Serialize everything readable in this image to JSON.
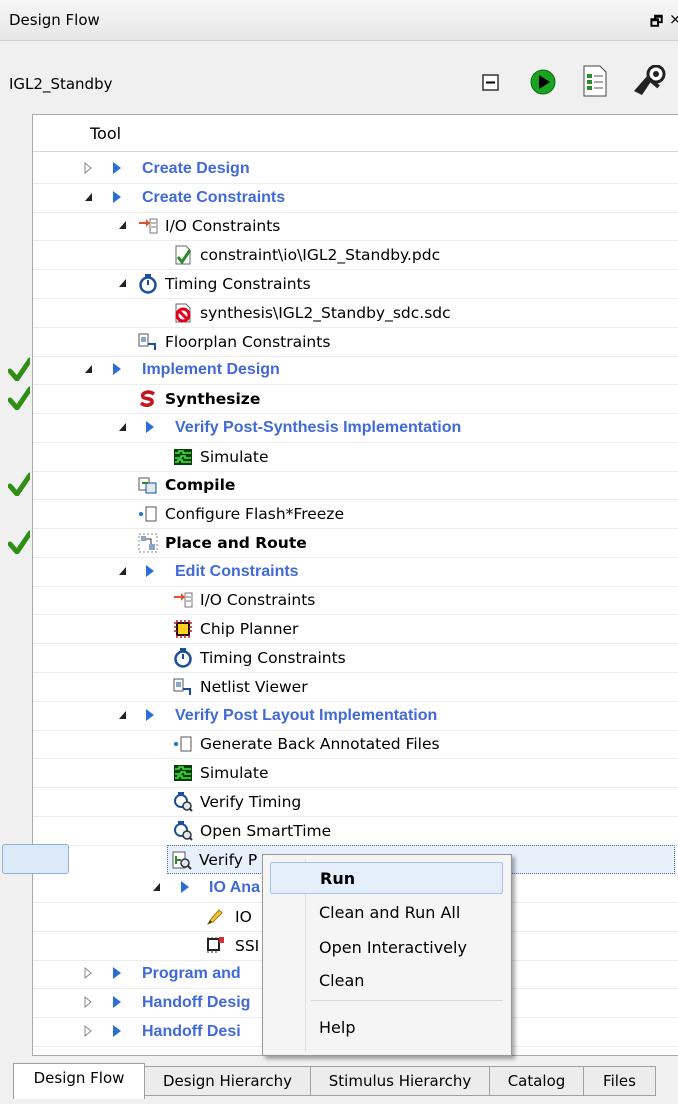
{
  "panel": {
    "title": "Design Flow",
    "restore_glyph": "🗗",
    "close_glyph": "×"
  },
  "project": {
    "name": "IGL2_Standby"
  },
  "toolbar": {
    "icons": [
      "collapse-icon",
      "run-icon",
      "report-icon",
      "configure-icon"
    ]
  },
  "tree": {
    "column_header": "Tool",
    "rows": [
      {
        "label": "Create Design",
        "style": "category",
        "check": false
      },
      {
        "label": "Create Constraints",
        "style": "category",
        "check": false
      },
      {
        "label": "I/O Constraints",
        "style": "normal",
        "check": false
      },
      {
        "label": "constraint\\io\\IGL2_Standby.pdc",
        "style": "normal",
        "check": false
      },
      {
        "label": "Timing Constraints",
        "style": "normal",
        "check": false
      },
      {
        "label": "synthesis\\IGL2_Standby_sdc.sdc",
        "style": "normal",
        "check": false
      },
      {
        "label": "Floorplan Constraints",
        "style": "normal",
        "check": false
      },
      {
        "label": "Implement Design",
        "style": "category",
        "check": true
      },
      {
        "label": "Synthesize",
        "style": "bold",
        "check": true
      },
      {
        "label": "Verify Post-Synthesis Implementation",
        "style": "category",
        "check": false
      },
      {
        "label": "Simulate",
        "style": "normal",
        "check": false
      },
      {
        "label": "Compile",
        "style": "bold",
        "check": true
      },
      {
        "label": "Configure Flash*Freeze",
        "style": "normal",
        "check": false
      },
      {
        "label": "Place and Route",
        "style": "bold",
        "check": true
      },
      {
        "label": "Edit Constraints",
        "style": "category",
        "check": false
      },
      {
        "label": "I/O Constraints",
        "style": "normal",
        "check": false
      },
      {
        "label": "Chip Planner",
        "style": "normal",
        "check": false
      },
      {
        "label": "Timing Constraints",
        "style": "normal",
        "check": false
      },
      {
        "label": "Netlist Viewer",
        "style": "normal",
        "check": false
      },
      {
        "label": "Verify Post Layout Implementation",
        "style": "category",
        "check": false
      },
      {
        "label": "Generate Back Annotated Files",
        "style": "normal",
        "check": false
      },
      {
        "label": "Simulate",
        "style": "normal",
        "check": false
      },
      {
        "label": "Verify Timing",
        "style": "normal",
        "check": false
      },
      {
        "label": "Open SmartTime",
        "style": "normal",
        "check": false
      },
      {
        "label": "Verify P",
        "style": "normal",
        "check": false,
        "selected": true
      },
      {
        "label": "IO Ana",
        "style": "category",
        "check": false
      },
      {
        "label": "IO",
        "style": "normal",
        "check": false
      },
      {
        "label": "SSI",
        "style": "normal",
        "check": false
      },
      {
        "label": "Program and",
        "style": "category",
        "check": false
      },
      {
        "label": "Handoff Desig",
        "style": "category",
        "check": false
      },
      {
        "label": "Handoff Desi",
        "style": "category",
        "check": false
      }
    ]
  },
  "context_menu": {
    "items": [
      {
        "label": "Run",
        "bold": true,
        "highlighted": true
      },
      {
        "label": "Clean and Run All"
      },
      {
        "label": "Open Interactively"
      },
      {
        "label": "Clean"
      },
      {
        "label": "Help"
      }
    ]
  },
  "tabs": [
    "Design Flow",
    "Design Hierarchy",
    "Stimulus Hierarchy",
    "Catalog",
    "Files"
  ],
  "active_tab": "Design Flow",
  "colors": {
    "category_text": "#4169d8",
    "check_green": "#3a9a1a",
    "selection": "#e8f1fb"
  }
}
